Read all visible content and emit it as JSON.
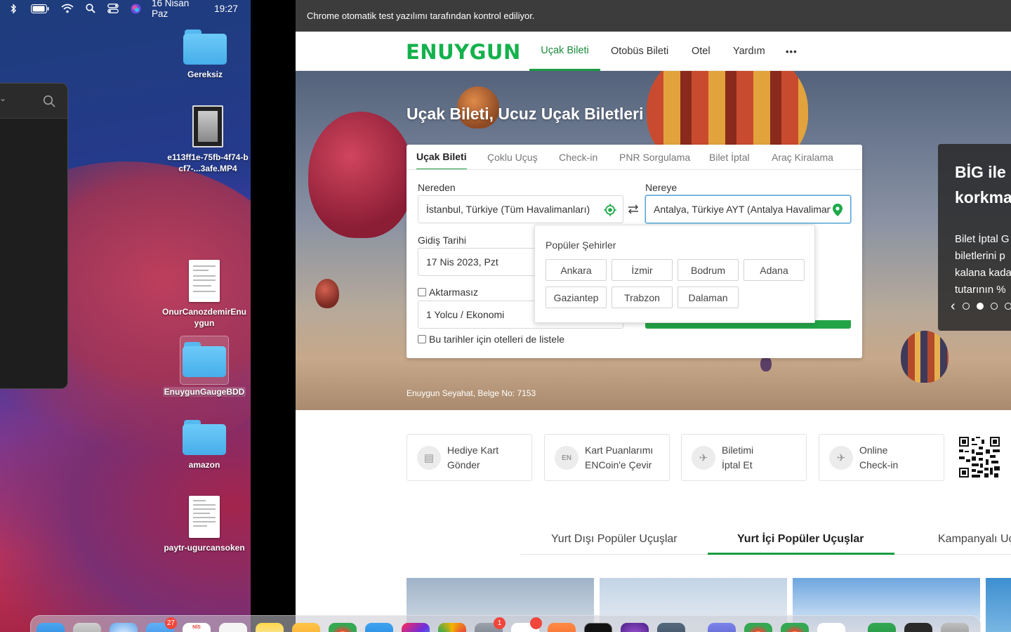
{
  "menubar": {
    "date": "16 Nisan Paz",
    "time": "19:27",
    "icons": [
      "bluetooth-icon",
      "battery-icon",
      "wifi-icon",
      "spotlight-icon",
      "control-center-icon",
      "siri-icon"
    ]
  },
  "desktop_items": [
    {
      "label": "Gereksiz",
      "kind": "folder"
    },
    {
      "label": "e113ff1e-75fb-4f74-bcf7-...3afe.MP4",
      "kind": "video"
    },
    {
      "label": "OnurCanozdemirEnuygun",
      "kind": "document"
    },
    {
      "label": "EnuygunGaugeBDD",
      "kind": "folder"
    },
    {
      "label": "amazon",
      "kind": "folder"
    },
    {
      "label": "paytr-ugurcansoken",
      "kind": "document"
    }
  ],
  "chrome": {
    "infobar": "Chrome otomatik test yazılımı tarafından kontrol ediliyor."
  },
  "site": {
    "logo": "ENUYGUN",
    "nav": [
      "Uçak Bileti",
      "Otobüs Bileti",
      "Otel",
      "Yardım",
      "•••"
    ],
    "hero_title": "Uçak Bileti, Ucuz Uçak Biletleri",
    "search_tabs": [
      "Uçak Bileti",
      "Çoklu Uçuş",
      "Check-in",
      "PNR Sorgulama",
      "Bilet İptal",
      "Araç Kiralama"
    ],
    "from_label": "Nereden",
    "from_value": "İstanbul, Türkiye (Tüm Havalimanları)",
    "to_label": "Nereye",
    "to_value": "Antalya, Türkiye AYT (Antalya Havalimanı)",
    "date_label": "Gidiş Tarihi",
    "date_value": "17 Nis 2023, Pzt",
    "nonstop_label": "Aktarmasız",
    "passenger_value": "1 Yolcu / Ekonomi",
    "hotels_label": "Bu tarihler için otelleri de listele",
    "popular_title": "Popüler Şehirler",
    "popular_cities": [
      "Ankara",
      "İzmir",
      "Bodrum",
      "Adana",
      "Gaziantep",
      "Trabzon",
      "Dalaman"
    ],
    "belge": "Enuygun Seyahat, Belge No: 7153",
    "promo_heading": [
      "BİG ile p",
      "korkma"
    ],
    "promo_text": [
      "Bilet İptal G",
      "biletlerini p",
      "kalana kada",
      "tutarının %"
    ],
    "promo_nav": {
      "prev": "‹"
    },
    "quick_links": [
      "Hediye Kart\nGönder",
      "Kart Puanlarımı\nENCoin'e Çevir",
      "Biletimi\nİptal Et",
      "Online\nCheck-in"
    ],
    "popular_tabs": [
      "Yurt Dışı Popüler Uçuşlar",
      "Yurt İçi Popüler Uçuşlar",
      "Kampanyalı Uç"
    ]
  },
  "dock": {
    "badges": {
      "mail": "27",
      "calendar": "NİS",
      "settings": "1"
    }
  },
  "colors": {
    "brand_green": "#14b14c",
    "accent_green": "#1b9c41",
    "infobar": "#3c3c3c"
  }
}
